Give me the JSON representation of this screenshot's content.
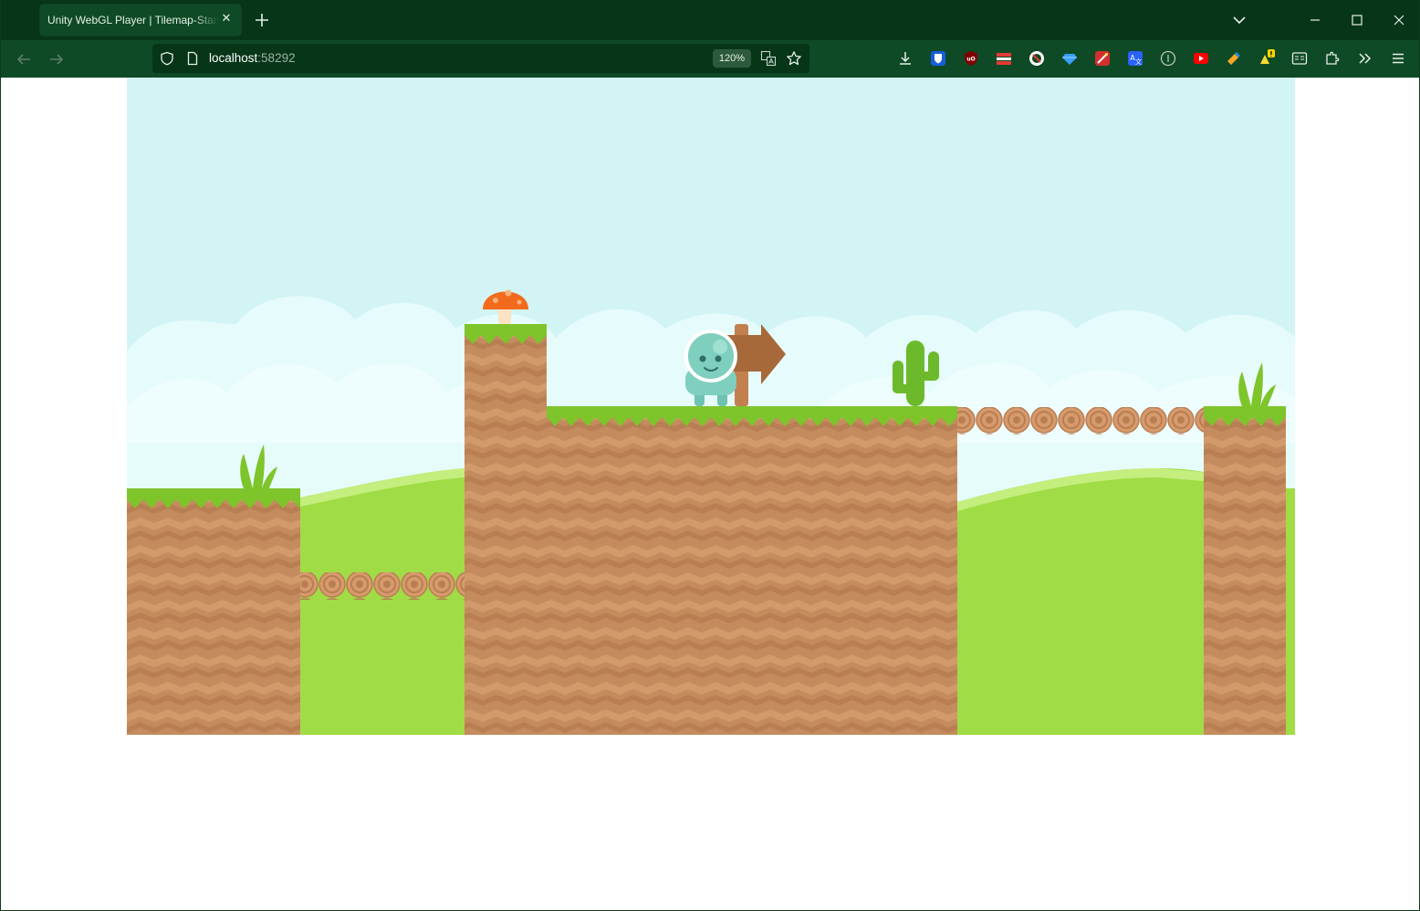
{
  "browser": {
    "tab_title": "Unity WebGL Player | Tilemap-Starter",
    "url_host": "localhost",
    "url_port": ":58292",
    "zoom": "120%"
  },
  "icons": {
    "back": "arrow-left-icon",
    "forward": "arrow-right-icon",
    "shield": "shield-icon",
    "page": "page-icon",
    "translate": "translate-icon",
    "bookmark": "star-icon",
    "download": "download-icon",
    "extensions": "puzzle-icon",
    "overflow": "chevron-double-right-icon",
    "menu": "hamburger-icon"
  },
  "colors": {
    "chrome_dark": "#063518",
    "chrome_mid": "#0e4a25",
    "sky": "#d3f4f5",
    "grass": "#7ec42b",
    "dirt": "#c98e60",
    "hill": "#a0dc45"
  }
}
